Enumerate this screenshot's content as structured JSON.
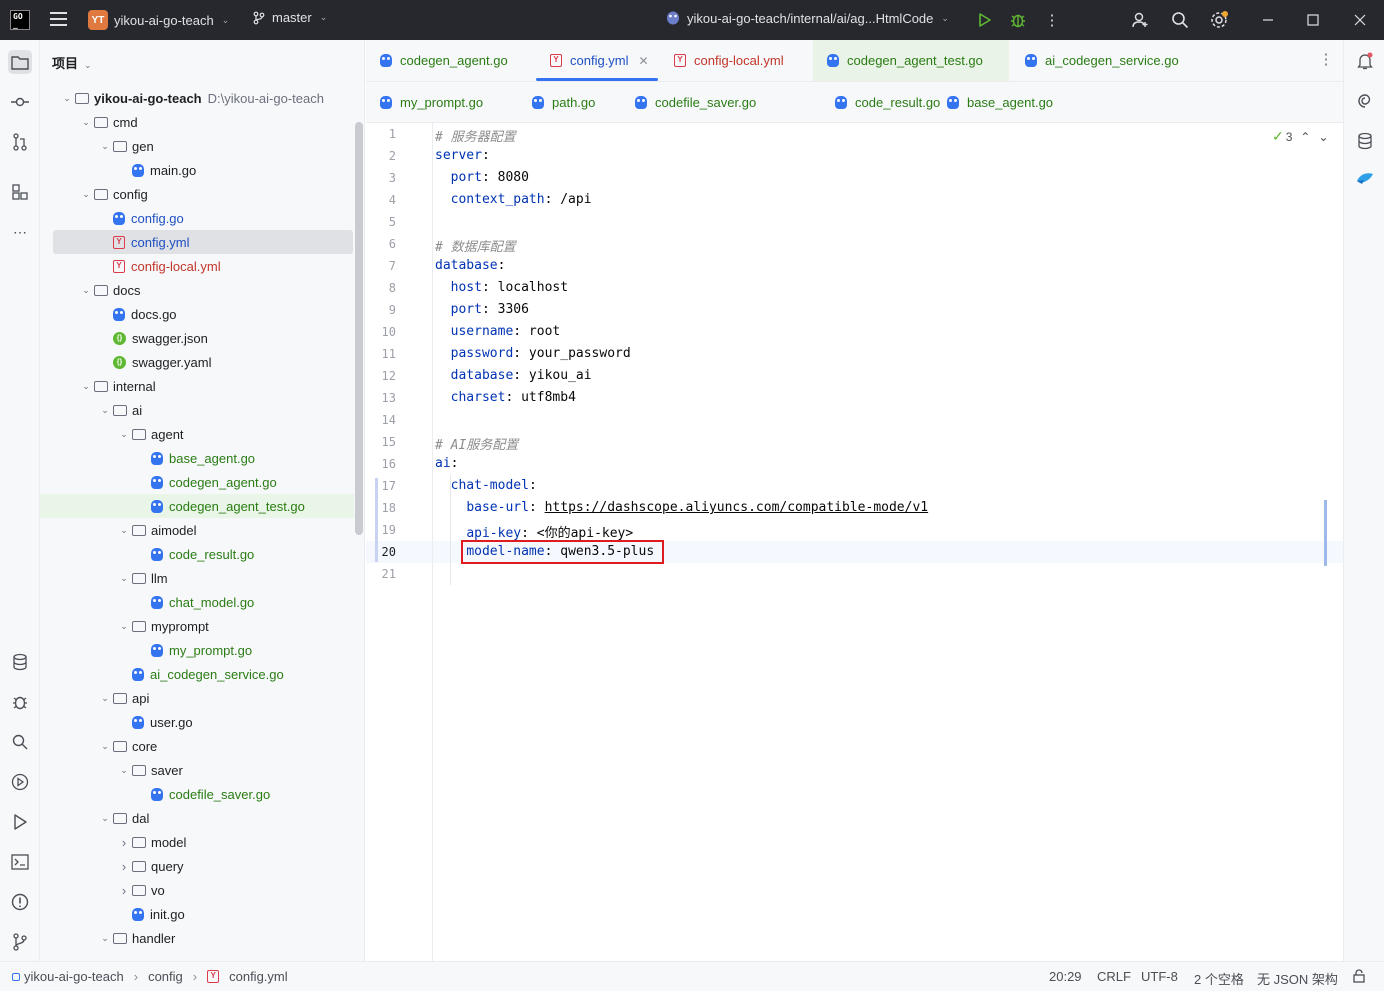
{
  "titlebar": {
    "project_badge": "YT",
    "project_name": "yikou-ai-go-teach",
    "branch": "master",
    "run_config": "yikou-ai-go-teach/internal/ai/ag...HtmlCode"
  },
  "project_panel": {
    "title": "项目",
    "tree": [
      {
        "label": "yikou-ai-go-teach",
        "path": "D:\\yikou-ai-go-teach",
        "kind": "folder",
        "depth": 0,
        "arrow": "open",
        "bold": true
      },
      {
        "label": "cmd",
        "kind": "folder",
        "depth": 1,
        "arrow": "open"
      },
      {
        "label": "gen",
        "kind": "folder",
        "depth": 2,
        "arrow": "open"
      },
      {
        "label": "main.go",
        "kind": "go",
        "depth": 3,
        "color": "normal"
      },
      {
        "label": "config",
        "kind": "folder",
        "depth": 1,
        "arrow": "open"
      },
      {
        "label": "config.go",
        "kind": "go",
        "depth": 2,
        "color": "blue"
      },
      {
        "label": "config.yml",
        "kind": "yml",
        "depth": 2,
        "color": "blue",
        "selected": true
      },
      {
        "label": "config-local.yml",
        "kind": "yml",
        "depth": 2,
        "color": "red"
      },
      {
        "label": "docs",
        "kind": "folder",
        "depth": 1,
        "arrow": "open"
      },
      {
        "label": "docs.go",
        "kind": "go",
        "depth": 2,
        "color": "normal"
      },
      {
        "label": "swagger.json",
        "kind": "json",
        "depth": 2,
        "color": "normal"
      },
      {
        "label": "swagger.yaml",
        "kind": "json",
        "depth": 2,
        "color": "normal"
      },
      {
        "label": "internal",
        "kind": "folder",
        "depth": 1,
        "arrow": "open"
      },
      {
        "label": "ai",
        "kind": "folder",
        "depth": 2,
        "arrow": "open"
      },
      {
        "label": "agent",
        "kind": "folder",
        "depth": 3,
        "arrow": "open"
      },
      {
        "label": "base_agent.go",
        "kind": "go",
        "depth": 4,
        "color": "green"
      },
      {
        "label": "codegen_agent.go",
        "kind": "go",
        "depth": 4,
        "color": "green"
      },
      {
        "label": "codegen_agent_test.go",
        "kind": "go",
        "depth": 4,
        "color": "green",
        "highlight": true
      },
      {
        "label": "aimodel",
        "kind": "folder",
        "depth": 3,
        "arrow": "open"
      },
      {
        "label": "code_result.go",
        "kind": "go",
        "depth": 4,
        "color": "green"
      },
      {
        "label": "llm",
        "kind": "folder",
        "depth": 3,
        "arrow": "open"
      },
      {
        "label": "chat_model.go",
        "kind": "go",
        "depth": 4,
        "color": "green"
      },
      {
        "label": "myprompt",
        "kind": "folder",
        "depth": 3,
        "arrow": "open"
      },
      {
        "label": "my_prompt.go",
        "kind": "go",
        "depth": 4,
        "color": "green"
      },
      {
        "label": "ai_codegen_service.go",
        "kind": "go",
        "depth": 3,
        "color": "green"
      },
      {
        "label": "api",
        "kind": "folder",
        "depth": 2,
        "arrow": "open"
      },
      {
        "label": "user.go",
        "kind": "go",
        "depth": 3,
        "color": "normal"
      },
      {
        "label": "core",
        "kind": "folder",
        "depth": 2,
        "arrow": "open"
      },
      {
        "label": "saver",
        "kind": "folder",
        "depth": 3,
        "arrow": "open"
      },
      {
        "label": "codefile_saver.go",
        "kind": "go",
        "depth": 4,
        "color": "green"
      },
      {
        "label": "dal",
        "kind": "folder",
        "depth": 2,
        "arrow": "open"
      },
      {
        "label": "model",
        "kind": "folder",
        "depth": 3,
        "arrow": "closed"
      },
      {
        "label": "query",
        "kind": "folder",
        "depth": 3,
        "arrow": "closed"
      },
      {
        "label": "vo",
        "kind": "folder",
        "depth": 3,
        "arrow": "closed"
      },
      {
        "label": "init.go",
        "kind": "go",
        "depth": 3,
        "color": "normal"
      },
      {
        "label": "handler",
        "kind": "folder",
        "depth": 2,
        "arrow": "open"
      }
    ]
  },
  "tabs_row1": [
    {
      "label": "codegen_agent.go",
      "kind": "go",
      "color": "green"
    },
    {
      "label": "config.yml",
      "kind": "yml",
      "color": "blue",
      "active": true,
      "closable": true
    },
    {
      "label": "config-local.yml",
      "kind": "yml",
      "color": "red"
    },
    {
      "label": "codegen_agent_test.go",
      "kind": "go",
      "color": "green",
      "highlight": true
    },
    {
      "label": "ai_codegen_service.go",
      "kind": "go",
      "color": "green"
    }
  ],
  "tabs_row2": [
    {
      "label": "my_prompt.go",
      "kind": "go",
      "color": "green"
    },
    {
      "label": "path.go",
      "kind": "go",
      "color": "green"
    },
    {
      "label": "codefile_saver.go",
      "kind": "go",
      "color": "green"
    },
    {
      "label": "code_result.go",
      "kind": "go",
      "color": "green"
    },
    {
      "label": "base_agent.go",
      "kind": "go",
      "color": "green"
    }
  ],
  "editor": {
    "inspection_count": "3",
    "current_line": 20,
    "lines": [
      [
        {
          "t": "# 服务器配置",
          "c": "c"
        }
      ],
      [
        {
          "t": "server",
          "c": "k"
        },
        {
          "t": ":"
        }
      ],
      [
        {
          "t": "  "
        },
        {
          "t": "port",
          "c": "k"
        },
        {
          "t": ": 8080"
        }
      ],
      [
        {
          "t": "  "
        },
        {
          "t": "context_path",
          "c": "k"
        },
        {
          "t": ": /api"
        }
      ],
      [],
      [
        {
          "t": "# 数据库配置",
          "c": "c"
        }
      ],
      [
        {
          "t": "database",
          "c": "k"
        },
        {
          "t": ":"
        }
      ],
      [
        {
          "t": "  "
        },
        {
          "t": "host",
          "c": "k"
        },
        {
          "t": ": localhost"
        }
      ],
      [
        {
          "t": "  "
        },
        {
          "t": "port",
          "c": "k"
        },
        {
          "t": ": 3306"
        }
      ],
      [
        {
          "t": "  "
        },
        {
          "t": "username",
          "c": "k"
        },
        {
          "t": ": root"
        }
      ],
      [
        {
          "t": "  "
        },
        {
          "t": "password",
          "c": "k"
        },
        {
          "t": ": your_password"
        }
      ],
      [
        {
          "t": "  "
        },
        {
          "t": "database",
          "c": "k"
        },
        {
          "t": ": yikou_ai"
        }
      ],
      [
        {
          "t": "  "
        },
        {
          "t": "charset",
          "c": "k"
        },
        {
          "t": ": utf8mb4"
        }
      ],
      [],
      [
        {
          "t": "# AI服务配置",
          "c": "c"
        }
      ],
      [
        {
          "t": "ai",
          "c": "k"
        },
        {
          "t": ":"
        }
      ],
      [
        {
          "t": "  "
        },
        {
          "t": "chat-model",
          "c": "k"
        },
        {
          "t": ":"
        }
      ],
      [
        {
          "t": "    "
        },
        {
          "t": "base-url",
          "c": "k"
        },
        {
          "t": ": "
        },
        {
          "t": "https://dashscope.aliyuncs.com/compatible-mode/v1",
          "c": "u"
        }
      ],
      [
        {
          "t": "    "
        },
        {
          "t": "api-key",
          "c": "k"
        },
        {
          "t": ": <你的api-key>"
        }
      ],
      [
        {
          "t": "    "
        },
        {
          "t": "model-name",
          "c": "k"
        },
        {
          "t": ": qwen3.5-plus"
        }
      ],
      []
    ]
  },
  "statusbar": {
    "breadcrumb": [
      "yikou-ai-go-teach",
      "config",
      "config.yml"
    ],
    "position": "20:29",
    "line_sep": "CRLF",
    "encoding": "UTF-8",
    "indent": "2 个空格",
    "schema": "无 JSON 架构"
  }
}
